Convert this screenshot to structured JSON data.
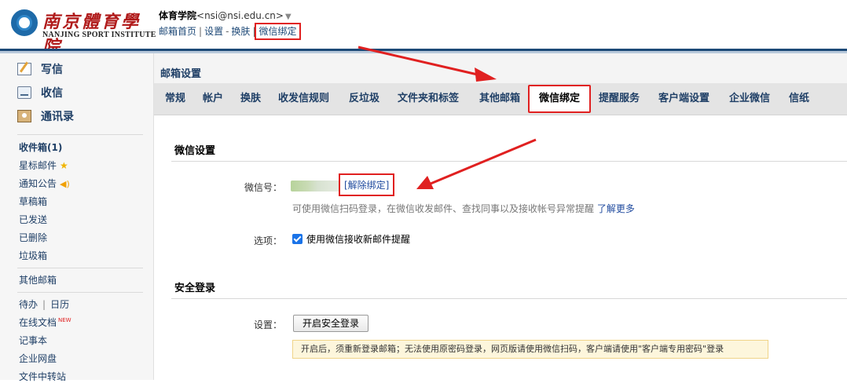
{
  "header": {
    "logo_cn": "南京體育學院",
    "logo_en": "NANJING SPORT INSTITUTE",
    "account_name": "体育学院",
    "account_email": "<nsi@nsi.edu.cn>",
    "links": [
      "邮箱首页",
      "设置",
      "换肤",
      "微信绑定"
    ]
  },
  "sidebar": {
    "big_items": [
      {
        "label": "写信",
        "icon": "pencil-icon"
      },
      {
        "label": "收信",
        "icon": "inbox-icon"
      },
      {
        "label": "通讯录",
        "icon": "contacts-icon"
      }
    ],
    "folders": [
      "收件箱(1)",
      "星标邮件",
      "通知公告",
      "草稿箱",
      "已发送",
      "已删除",
      "垃圾箱"
    ],
    "other_mail": "其他邮箱",
    "tools": {
      "todo": "待办",
      "calendar": "日历",
      "online_docs": "在线文档",
      "new_badge": "NEW",
      "notes": "记事本",
      "netdisk": "企业网盘",
      "transfer": "文件中转站"
    }
  },
  "main": {
    "page_title": "邮箱设置",
    "tabs": [
      "常规",
      "帐户",
      "换肤",
      "收发信规则",
      "反垃圾",
      "文件夹和标签",
      "其他邮箱",
      "微信绑定",
      "提醒服务",
      "客户端设置",
      "企业微信",
      "信纸"
    ],
    "active_tab": "微信绑定",
    "wechat_section": {
      "title": "微信设置",
      "id_label": "微信号：",
      "unbind_link": "[解除绑定]",
      "hint": "可使用微信扫码登录，在微信收发邮件、查找同事以及接收帐号异常提醒",
      "learn_more": "了解更多",
      "option_label": "选项：",
      "option_text": "使用微信接收新邮件提醒",
      "option_checked": true
    },
    "security_section": {
      "title": "安全登录",
      "setting_label": "设置：",
      "button": "开启安全登录",
      "notice": "开启后，须重新登录邮箱；无法使用原密码登录，网页版请使用微信扫码，客户端请使用\"客户端专用密码\"登录"
    }
  },
  "colors": {
    "link": "#1f4a78",
    "highlight": "#e02020",
    "header_bar": "#1e4a78",
    "notice_bg": "#fdf6dc"
  }
}
